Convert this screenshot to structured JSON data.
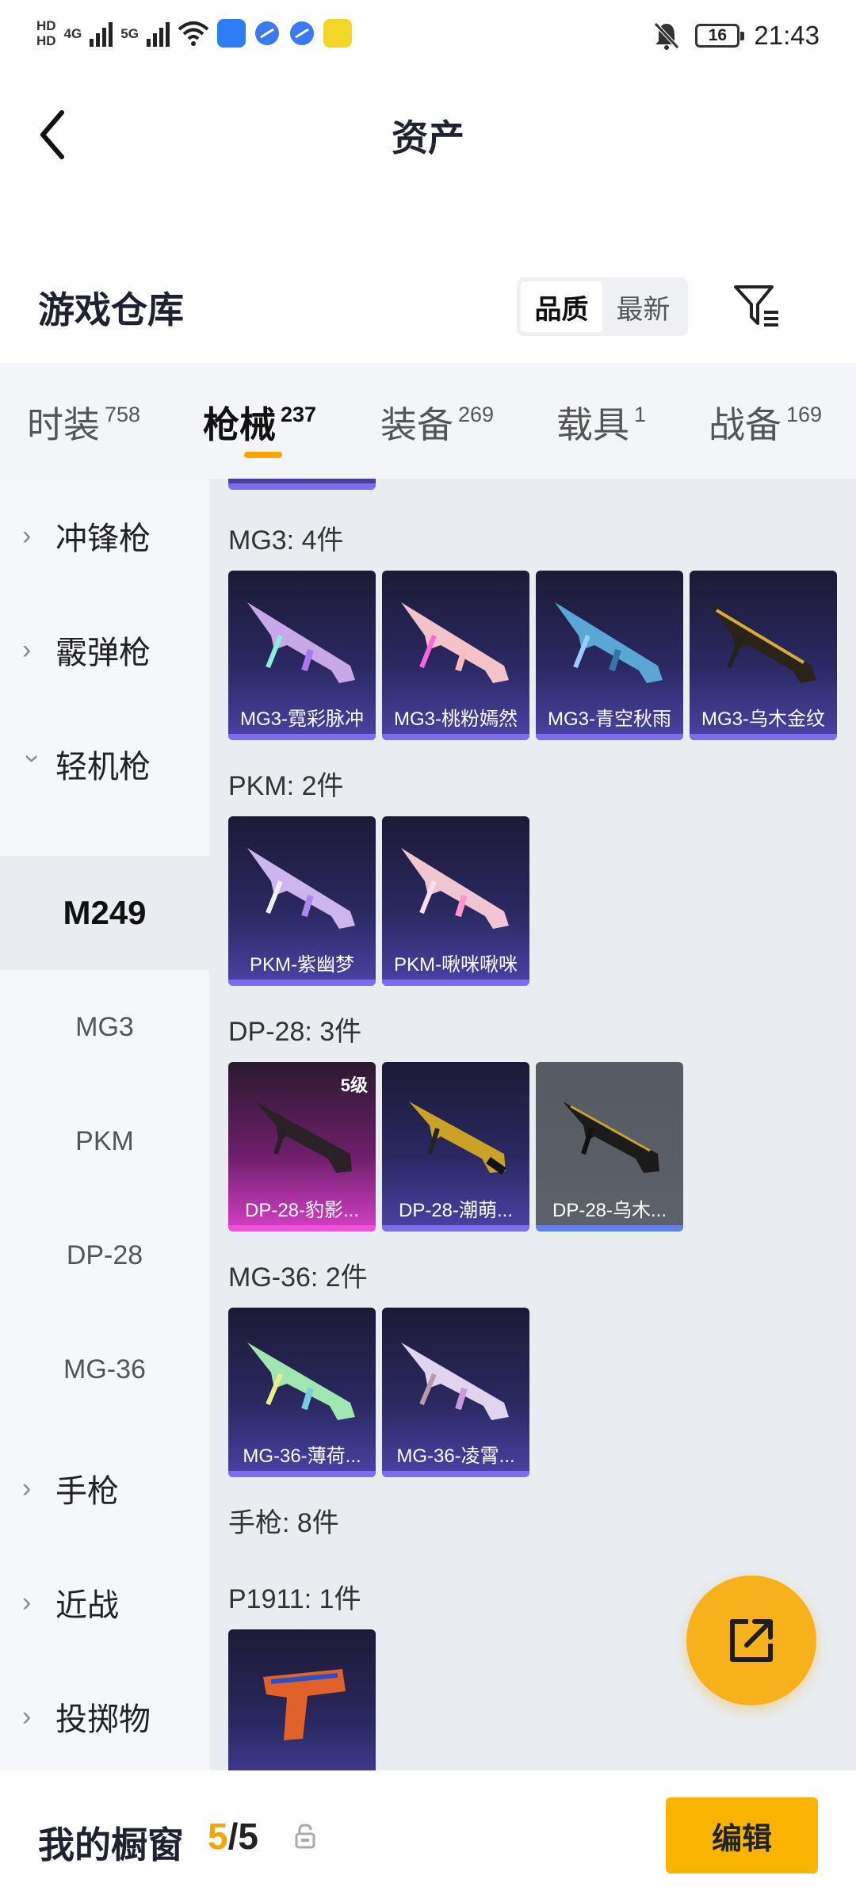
{
  "status_bar": {
    "hd1": "HD",
    "hd2": "HD",
    "net1": "4G",
    "net2": "5G",
    "battery": "16",
    "time": "21:43"
  },
  "header": {
    "title": "资产"
  },
  "warehouse": {
    "title": "游戏仓库",
    "sort_options": [
      "品质",
      "最新"
    ]
  },
  "tabs": [
    {
      "label": "时装",
      "count": "758"
    },
    {
      "label": "枪械",
      "count": "237"
    },
    {
      "label": "装备",
      "count": "269"
    },
    {
      "label": "载具",
      "count": "1"
    },
    {
      "label": "战备",
      "count": "169"
    }
  ],
  "sidebar": {
    "items": [
      {
        "label": "冲锋枪"
      },
      {
        "label": "霰弹枪"
      },
      {
        "label": "轻机枪"
      },
      {
        "label": "M249"
      },
      {
        "label": "MG3"
      },
      {
        "label": "PKM"
      },
      {
        "label": "DP-28"
      },
      {
        "label": "MG-36"
      },
      {
        "label": "手枪"
      },
      {
        "label": "近战"
      },
      {
        "label": "投掷物"
      }
    ]
  },
  "groups": [
    {
      "title": "MG3: 4件",
      "items": [
        "MG3-霓彩脉冲",
        "MG3-桃粉嫣然",
        "MG3-青空秋雨",
        "MG3-乌木金纹"
      ]
    },
    {
      "title": "PKM: 2件",
      "items": [
        "PKM-紫幽梦",
        "PKM-啾咪啾咪"
      ]
    },
    {
      "title": "DP-28: 3件",
      "items": [
        "DP-28-豹影...",
        "DP-28-潮萌...",
        "DP-28-乌木..."
      ],
      "level": "5级"
    },
    {
      "title": "MG-36: 2件",
      "items": [
        "MG-36-薄荷...",
        "MG-36-凌霄..."
      ]
    },
    {
      "title": "手枪: 8件"
    },
    {
      "title": "P1911: 1件"
    }
  ],
  "bottom": {
    "title": "我的橱窗",
    "count_current": "5",
    "count_sep": "/",
    "count_total": "5",
    "edit_label": "编辑"
  },
  "colors": {
    "accent": "#f9b400",
    "card_purple": "#4a43a6",
    "card_pink": "#d640c8",
    "card_grey": "#5d6169"
  }
}
